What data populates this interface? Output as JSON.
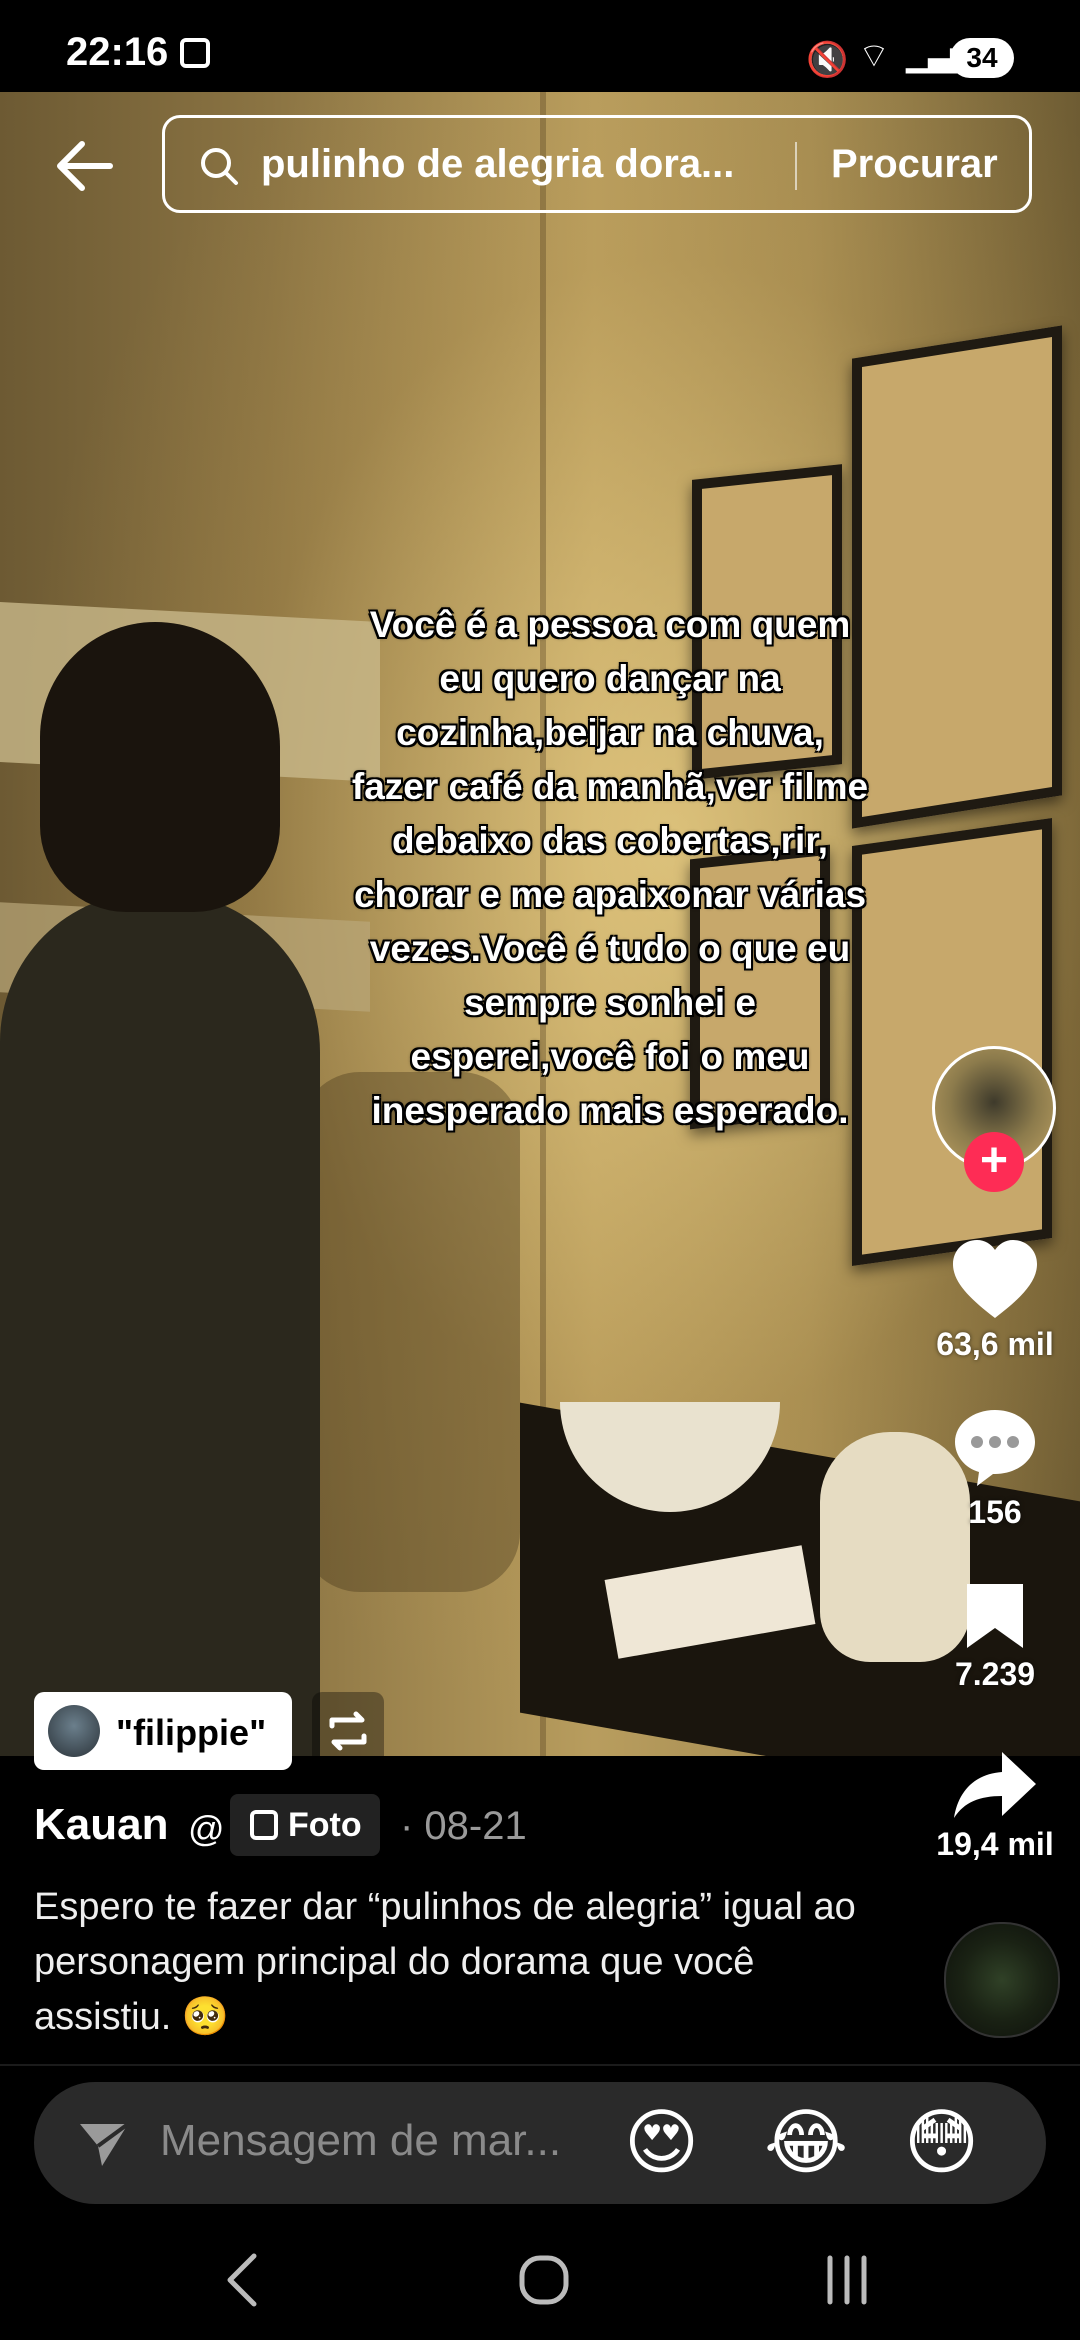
{
  "status_bar": {
    "time": "22:16",
    "battery": "34",
    "icons": [
      "screenshot-icon",
      "mute-icon",
      "wifi-icon",
      "signal-icon"
    ]
  },
  "search": {
    "query": "pulinho de alegria dora...",
    "submit_label": "Procurar"
  },
  "photo": {
    "overlay_text": "Você é a pessoa com quem eu quero dançar na cozinha,beijar na chuva, fazer café da manhã,ver filme debaixo das cobertas,rir, chorar e me apaixonar várias vezes.Você é tudo o que eu sempre sonhei e esperei,você foi o meu inesperado mais esperado."
  },
  "actions": {
    "likes": "63,6 mil",
    "comments": "156",
    "saves": "7.239",
    "shares": "19,4 mil"
  },
  "sound": {
    "username": "\"filippie\""
  },
  "post": {
    "author": "Kauan",
    "type_label": "Foto",
    "date": "· 08-21",
    "caption": "Espero te fazer dar “pulinhos de alegria” igual ao personagem principal do dorama que você assistiu. 🥺"
  },
  "message_bar": {
    "placeholder": "Mensagem de mar...",
    "quick_emojis": [
      "😍",
      "😂",
      "😳"
    ]
  },
  "colors": {
    "accent": "#fe2c55",
    "background": "#000000"
  }
}
